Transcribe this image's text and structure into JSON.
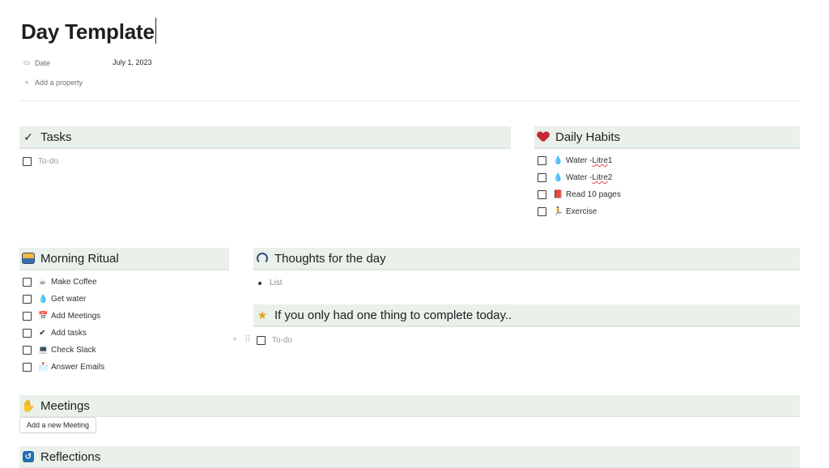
{
  "page": {
    "title": "Day Template",
    "properties": {
      "date_label": "Date",
      "date_value": "July 1, 2023",
      "add_property": "Add a property"
    }
  },
  "tasks": {
    "heading": "Tasks",
    "items": [
      {
        "label": "To-do"
      }
    ]
  },
  "habits": {
    "heading": "Daily Habits",
    "items": [
      {
        "emoji": "💧",
        "label_a": "Water - ",
        "label_b": "Litre",
        "label_c": " 1"
      },
      {
        "emoji": "💧",
        "label_a": "Water - ",
        "label_b": "Litre",
        "label_c": " 2"
      },
      {
        "emoji": "📕",
        "label": "Read 10 pages"
      },
      {
        "emoji": "🏃",
        "label": "Exercise"
      }
    ]
  },
  "morning": {
    "heading": "Morning Ritual",
    "items": [
      {
        "emoji": "☕",
        "label": "Make Coffee"
      },
      {
        "emoji": "💧",
        "label": "Get water"
      },
      {
        "emoji": "📅",
        "label": "Add Meetings"
      },
      {
        "emoji": "✔",
        "label": "Add tasks"
      },
      {
        "emoji": "💻",
        "label": "Check Slack"
      },
      {
        "emoji": "📩",
        "label": "Answer Emails"
      }
    ]
  },
  "thoughts": {
    "heading": "Thoughts for the day",
    "bullet": "List"
  },
  "one_thing": {
    "heading": "If you only had one thing to complete today..",
    "todo": "To-do"
  },
  "meetings": {
    "heading": "Meetings",
    "button": "Add a new Meeting"
  },
  "reflections": {
    "heading": "Reflections"
  },
  "colors": {
    "header_bg": "#eaf0ea",
    "heart": "#c22a36",
    "star": "#e6a21d"
  }
}
